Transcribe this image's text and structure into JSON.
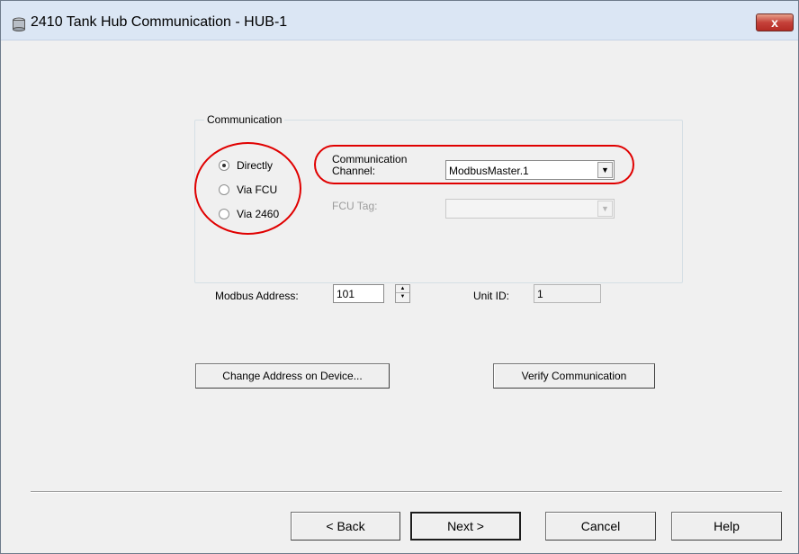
{
  "window": {
    "title": "2410 Tank Hub Communication - HUB-1",
    "close_glyph": "x"
  },
  "communication": {
    "group_label": "Communication",
    "radios": [
      {
        "label": "Directly",
        "checked": true
      },
      {
        "label": "Via FCU",
        "checked": false
      },
      {
        "label": "Via 2460",
        "checked": false
      }
    ],
    "channel_label_line1": "Communication",
    "channel_label_line2": "Channel:",
    "channel_value": "ModbusMaster.1",
    "fcu_tag_label": "FCU Tag:",
    "fcu_tag_value": ""
  },
  "modbus": {
    "address_label": "Modbus Address:",
    "address_value": "101",
    "unit_id_label": "Unit ID:",
    "unit_id_value": "1"
  },
  "actions": {
    "change_address_label": "Change Address on Device...",
    "verify_label": "Verify Communication"
  },
  "footer": {
    "back_label": "< Back",
    "next_label": "Next >",
    "cancel_label": "Cancel",
    "help_label": "Help"
  },
  "icons": {
    "title_icon": "tank-icon",
    "dropdown": "chevron-down-icon",
    "spin_up": "spin-up-icon",
    "spin_down": "spin-down-icon"
  },
  "colors": {
    "highlight": "#e00000",
    "close_button": "#c5413a",
    "titlebar": "#dbe6f4"
  }
}
